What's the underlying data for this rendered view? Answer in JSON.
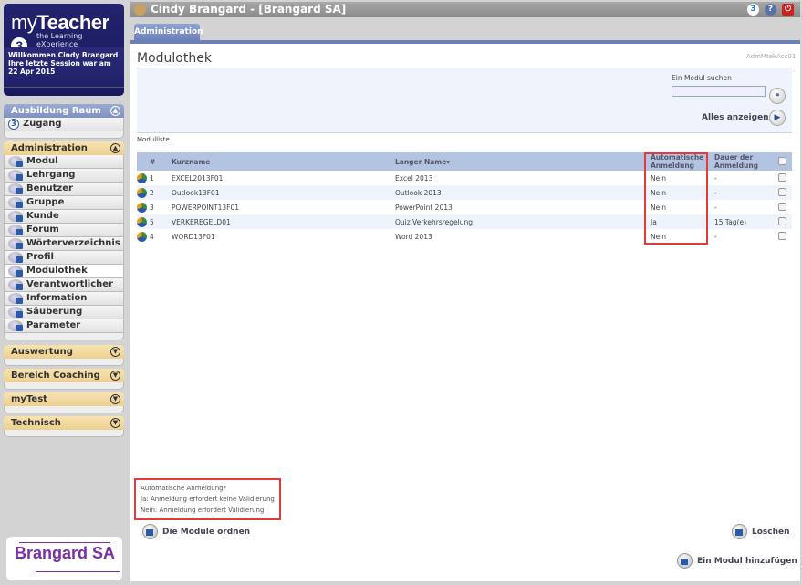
{
  "logo": {
    "brand_light": "my",
    "brand_bold": "Teacher",
    "brand_num": "3",
    "tagline": "the Learning eXperience",
    "welcome_line1": "Willkommen Cindy Brangard",
    "welcome_line2": "Ihre letzte Session war am 22 Apr 2015"
  },
  "sidebar": {
    "ausbildung": {
      "title": "Ausbildung Raum",
      "items": [
        {
          "label": "Zugang",
          "icon": "mt3-icon"
        }
      ]
    },
    "administration": {
      "title": "Administration",
      "items": [
        {
          "label": "Modul",
          "icon": "modul-icon"
        },
        {
          "label": "Lehrgang",
          "icon": "lehrgang-icon"
        },
        {
          "label": "Benutzer",
          "icon": "benutzer-icon"
        },
        {
          "label": "Gruppe",
          "icon": "gruppe-icon"
        },
        {
          "label": "Kunde",
          "icon": "kunde-icon"
        },
        {
          "label": "Forum",
          "icon": "forum-icon"
        },
        {
          "label": "Wörterverzeichnis",
          "icon": "glossary-icon"
        },
        {
          "label": "Profil",
          "icon": "key-icon"
        },
        {
          "label": "Modulothek",
          "icon": "modulothek-icon",
          "active": true
        },
        {
          "label": "Verantwortlicher",
          "icon": "manager-icon"
        },
        {
          "label": "Information",
          "icon": "info-icon"
        },
        {
          "label": "Säuberung",
          "icon": "clean-icon"
        },
        {
          "label": "Parameter",
          "icon": "parameter-icon"
        }
      ]
    },
    "collapsed": [
      "Auswertung",
      "Bereich Coaching",
      "myTest",
      "Technisch"
    ]
  },
  "company_logo": "Brangard SA",
  "titlebar": {
    "title": "Cindy Brangard - [Brangard SA]",
    "icons": [
      "mt3-icon",
      "help-icon",
      "power-icon"
    ]
  },
  "tabs": [
    {
      "label": "Administration",
      "active": true
    }
  ],
  "page": {
    "title": "Modulothek",
    "code": "AdmMtekAcc01",
    "search_label": "Ein Modul suchen",
    "search_value": "",
    "show_all": "Alles anzeigen",
    "list_label": "Modulliste"
  },
  "table": {
    "headers": [
      "#",
      "Kurzname",
      "Langer Name",
      "Automatische Anmeldung",
      "Dauer der Anmeldung"
    ],
    "sort_column": "Langer Name",
    "rows": [
      {
        "num": "1",
        "short": "EXCEL2013F01",
        "long": "Excel 2013",
        "auto": "Nein",
        "duration": "-"
      },
      {
        "num": "2",
        "short": "Outlook13F01",
        "long": "Outlook 2013",
        "auto": "Nein",
        "duration": "-"
      },
      {
        "num": "3",
        "short": "POWERPOINT13F01",
        "long": "PowerPoint 2013",
        "auto": "Nein",
        "duration": "-"
      },
      {
        "num": "5",
        "short": "VERKEREGELD01",
        "long": "Quiz Verkehrsregelung",
        "auto": "Ja",
        "duration": "15 Tag(e)"
      },
      {
        "num": "4",
        "short": "WORD13F01",
        "long": "Word 2013",
        "auto": "Nein",
        "duration": "-"
      }
    ]
  },
  "legend": {
    "title": "Automatische Anmeldung*",
    "ja": "Ja: Anmeldung erfordert keine Validierung",
    "nein": "Nein: Anmeldung erfordert Validierung"
  },
  "actions": {
    "order": "Die Module ordnen",
    "delete": "Löschen",
    "add": "Ein Modul hinzufügen"
  },
  "colors": {
    "highlight": "#e03c3c",
    "header_blue": "#b2c4e2",
    "nav_tan": "#f0d9a0",
    "logo_navy": "#1f1f6b"
  }
}
